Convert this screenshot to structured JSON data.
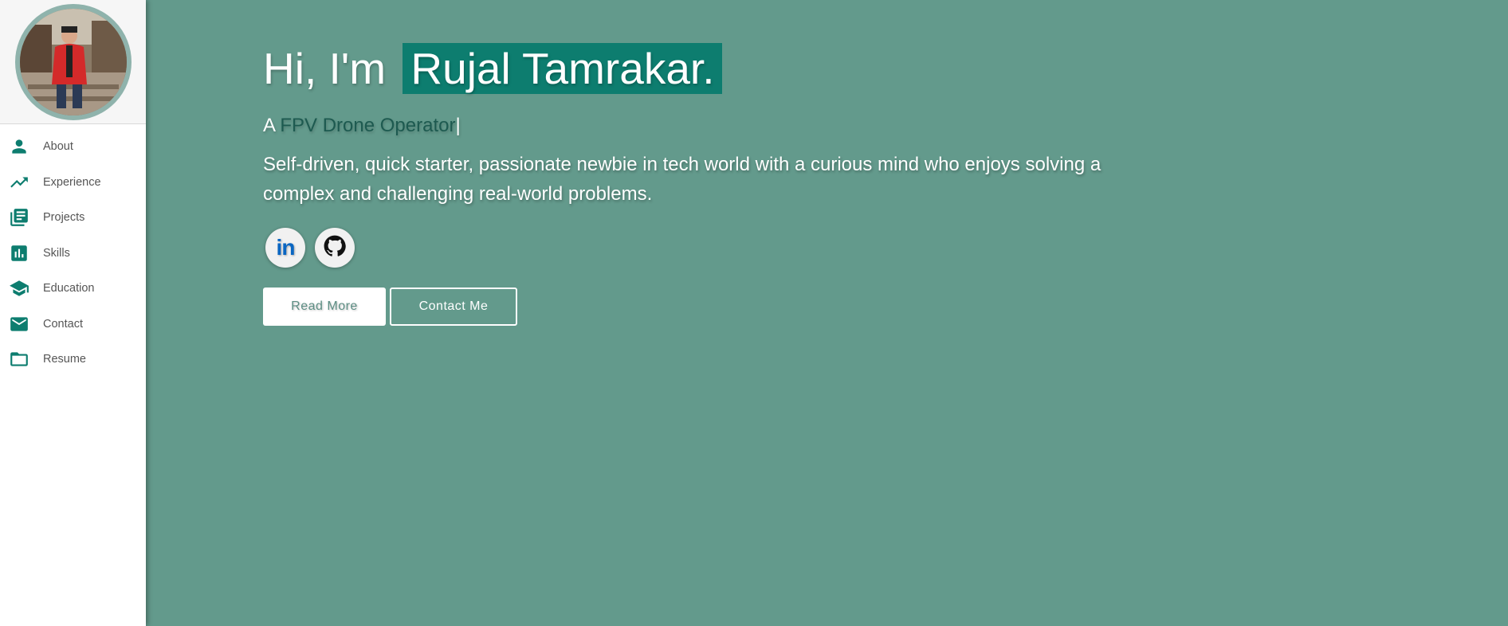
{
  "sidebar": {
    "avatar_alt": "profile photo",
    "items": [
      {
        "label": "About",
        "icon": "person-icon"
      },
      {
        "label": "Experience",
        "icon": "trending-up-icon"
      },
      {
        "label": "Projects",
        "icon": "library-books-icon"
      },
      {
        "label": "Skills",
        "icon": "bar-chart-icon"
      },
      {
        "label": "Education",
        "icon": "school-icon"
      },
      {
        "label": "Contact",
        "icon": "mail-icon"
      },
      {
        "label": "Resume",
        "icon": "folder-icon"
      }
    ]
  },
  "hero": {
    "greeting_prefix": "Hi, I'm",
    "name": "Rujal Tamrakar.",
    "tagline_prefix": "A",
    "role": "FPV Drone Operator",
    "cursor": "|",
    "description": "Self-driven, quick starter, passionate newbie in tech world with a curious mind who enjoys solving a complex and challenging real-world problems."
  },
  "socials": [
    {
      "name": "linkedin-icon",
      "text": "in"
    },
    {
      "name": "github-icon"
    }
  ],
  "buttons": {
    "read_more": "Read More",
    "contact_me": "Contact Me"
  },
  "colors": {
    "background": "#639a8c",
    "accent": "#0d7d6f",
    "role_text": "#1d5a50",
    "linkedin": "#0a66c2"
  }
}
